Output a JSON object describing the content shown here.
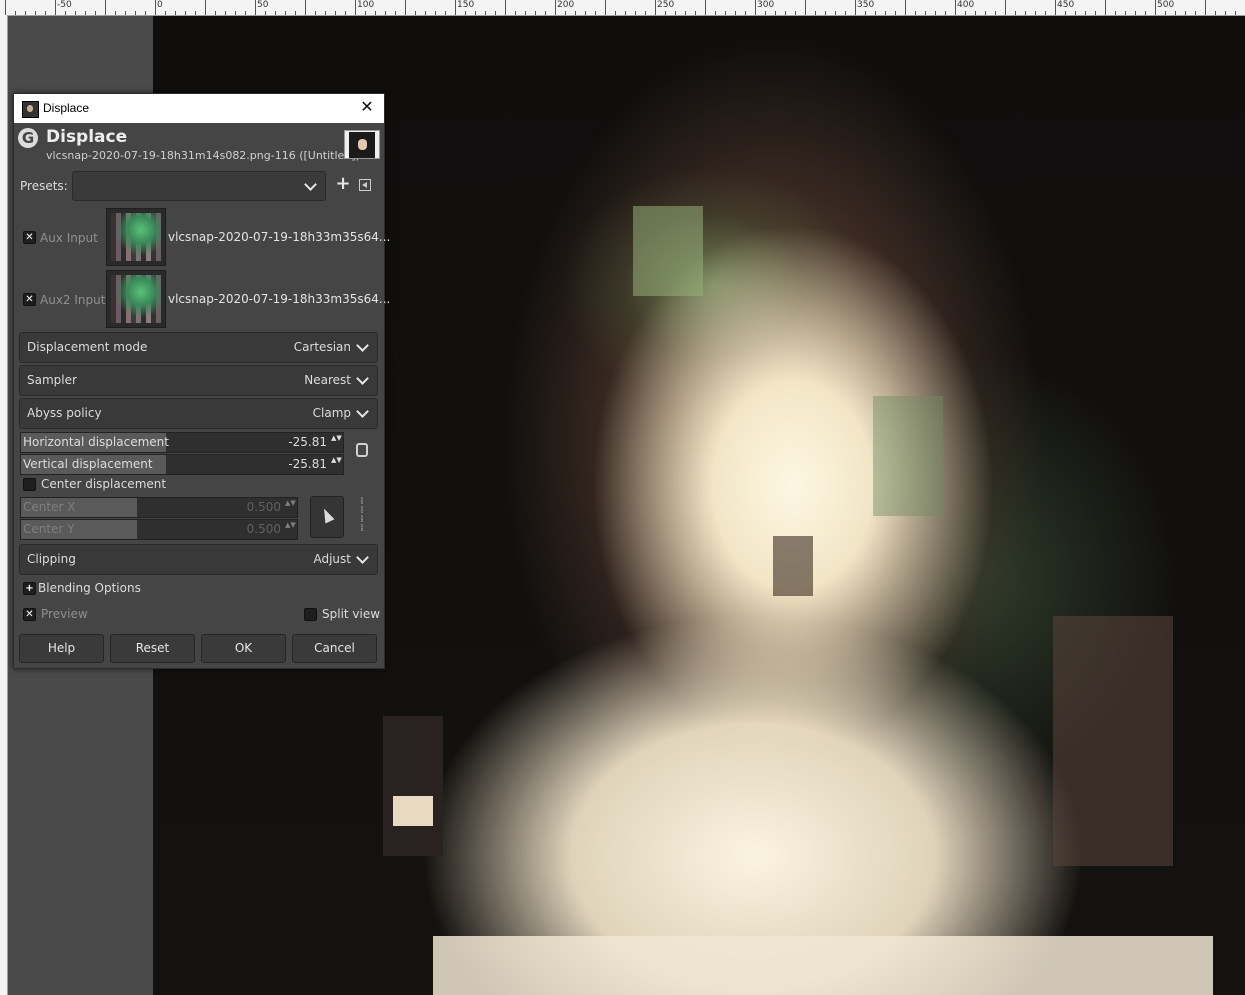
{
  "ruler": {
    "labels": [
      "-50",
      "0",
      "50",
      "100",
      "150",
      "200",
      "250",
      "300",
      "350",
      "400",
      "450",
      "500"
    ]
  },
  "dialog": {
    "window_title": "Displace",
    "close_glyph": "✕",
    "header_title": "Displace",
    "header_subtitle": "vlcsnap-2020-07-19-18h31m14s082.png-116 ([Untitled])",
    "gegl_glyph": "G",
    "presets_label": "Presets:",
    "presets_value": "",
    "aux_input": {
      "label": "Aux Input",
      "checked": true,
      "filename": "vlcsnap-2020-07-19-18h33m35s64..."
    },
    "aux2_input": {
      "label": "Aux2 Input",
      "checked": true,
      "filename": "vlcsnap-2020-07-19-18h33m35s64..."
    },
    "displacement_mode": {
      "label": "Displacement mode",
      "value": "Cartesian"
    },
    "sampler": {
      "label": "Sampler",
      "value": "Nearest"
    },
    "abyss_policy": {
      "label": "Abyss policy",
      "value": "Clamp"
    },
    "horizontal_displacement": {
      "label": "Horizontal displacement",
      "value": "-25.81",
      "fill_fraction": 0.45
    },
    "vertical_displacement": {
      "label": "Vertical displacement",
      "value": "-25.81",
      "fill_fraction": 0.45
    },
    "center_displacement": {
      "label": "Center displacement",
      "checked": false
    },
    "center_x": {
      "label": "Center X",
      "value": "0.500",
      "fill_fraction": 0.42
    },
    "center_y": {
      "label": "Center Y",
      "value": "0.500",
      "fill_fraction": 0.42
    },
    "clipping": {
      "label": "Clipping",
      "value": "Adjust"
    },
    "blending_options": {
      "label": "Blending Options",
      "glyph": "+"
    },
    "preview": {
      "label": "Preview",
      "checked": true
    },
    "split_view": {
      "label": "Split view",
      "checked": false
    },
    "buttons": {
      "help": "Help",
      "reset": "Reset",
      "ok": "OK",
      "cancel": "Cancel"
    },
    "check_glyph": "✕",
    "plus_glyph": "+",
    "spin_arrows": "▲▼"
  },
  "icons": {
    "app": "gimp-wilber-icon",
    "gegl": "gegl-operation-icon",
    "add_preset": "plus-icon",
    "preset_menu": "menu-icon",
    "chain": "chain-link-icon",
    "picker": "pointer-arrow-icon"
  }
}
